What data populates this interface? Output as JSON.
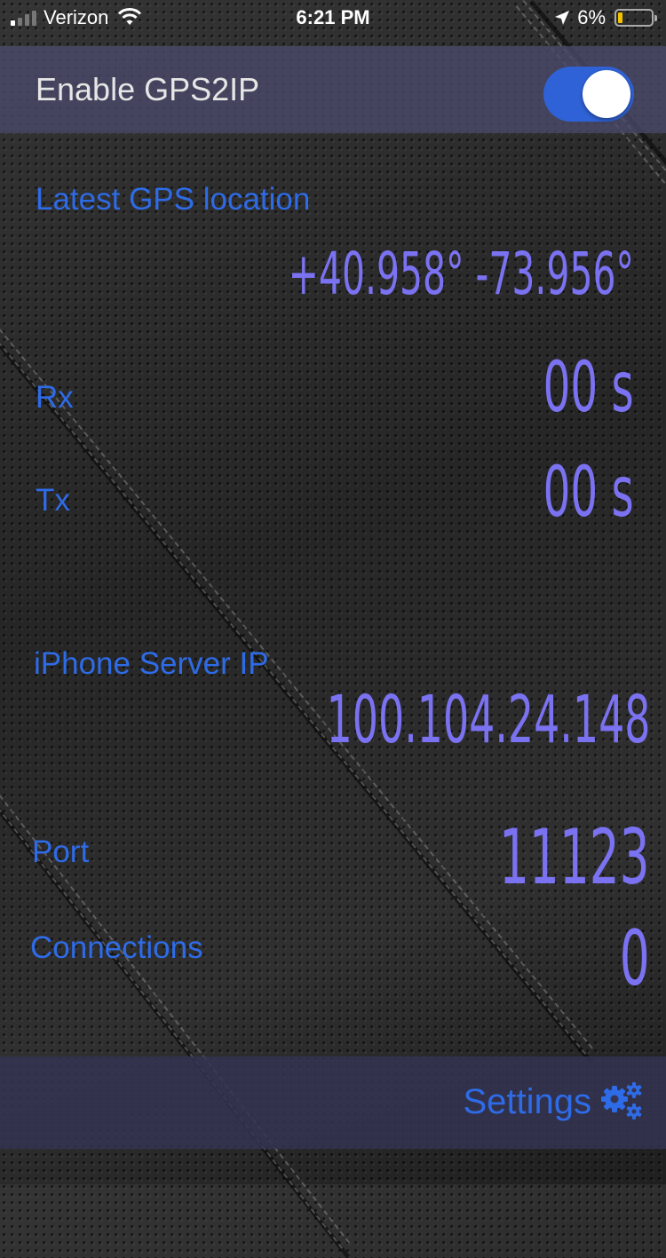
{
  "status_bar": {
    "carrier": "Verizon",
    "time": "6:21 PM",
    "battery_percent": "6%",
    "signal_bars_active": 1,
    "signal_bars_total": 4,
    "icons": [
      "signal-bars-icon",
      "wifi-icon",
      "location-arrow-icon",
      "battery-icon"
    ]
  },
  "header": {
    "title": "Enable GPS2IP",
    "toggle_on": true
  },
  "gps": {
    "label": "Latest GPS location",
    "value": "+40.958° -73.956°"
  },
  "rx": {
    "label": "Rx",
    "value": "00 s"
  },
  "tx": {
    "label": "Tx",
    "value": "00 s"
  },
  "server": {
    "label": "iPhone Server IP",
    "value": "100.104.24.148"
  },
  "port": {
    "label": "Port",
    "value": "11123"
  },
  "connections": {
    "label": "Connections",
    "value": "0"
  },
  "footer": {
    "settings_label": "Settings",
    "settings_icon": "gears-icon"
  },
  "colors": {
    "accent_blue": "#2e6be6",
    "value_purple": "#7b72f2",
    "toggle_on": "#2f62d6",
    "bar_overlay": "#4a4a6c"
  }
}
